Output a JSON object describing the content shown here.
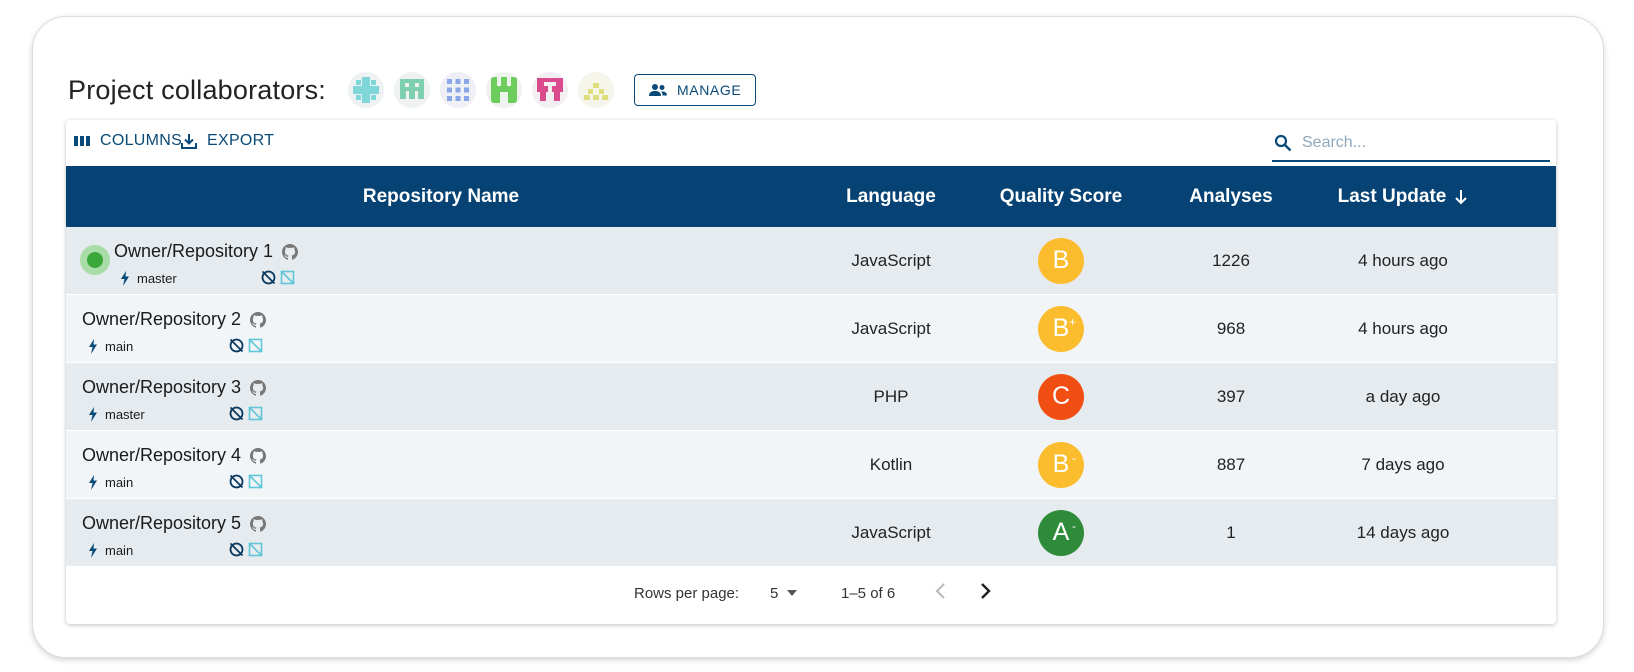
{
  "header": {
    "title": "Project collaborators:",
    "manage_label": "MANAGE",
    "avatars": [
      {
        "icon": "identicon-cyan",
        "color": "#7fd6d9"
      },
      {
        "icon": "identicon-mint",
        "color": "#7fd0b0"
      },
      {
        "icon": "identicon-blue",
        "color": "#8aa8e8"
      },
      {
        "icon": "identicon-green",
        "color": "#6ccc5c"
      },
      {
        "icon": "identicon-pink",
        "color": "#d94b8c"
      },
      {
        "icon": "identicon-yellow",
        "color": "#dede7c"
      }
    ]
  },
  "toolbar": {
    "columns_label": "COLUMNS",
    "export_label": "EXPORT",
    "search_placeholder": "Search..."
  },
  "table": {
    "columns": {
      "repository": "Repository Name",
      "language": "Language",
      "quality": "Quality Score",
      "analyses": "Analyses",
      "last_update": "Last Update"
    },
    "rows": [
      {
        "name": "Owner/Repository 1",
        "branch": "master",
        "language": "JavaScript",
        "grade": "B",
        "grade_mod": "",
        "grade_color": "#fbbc2e",
        "analyses": "1226",
        "last_update": "4 hours ago",
        "active": true
      },
      {
        "name": "Owner/Repository 2",
        "branch": "main",
        "language": "JavaScript",
        "grade": "B",
        "grade_mod": "+",
        "grade_color": "#fbbc2e",
        "analyses": "968",
        "last_update": "4 hours ago",
        "active": false
      },
      {
        "name": "Owner/Repository 3",
        "branch": "master",
        "language": "PHP",
        "grade": "C",
        "grade_mod": "",
        "grade_color": "#f04e12",
        "analyses": "397",
        "last_update": "a day ago",
        "active": false
      },
      {
        "name": "Owner/Repository 4",
        "branch": "main",
        "language": "Kotlin",
        "grade": "B",
        "grade_mod": "-",
        "grade_color": "#fbbc2e",
        "analyses": "887",
        "last_update": "7 days ago",
        "active": false
      },
      {
        "name": "Owner/Repository 5",
        "branch": "main",
        "language": "JavaScript",
        "grade": "A",
        "grade_mod": "-",
        "grade_color": "#2e8b3a",
        "analyses": "1",
        "last_update": "14 days ago",
        "active": false
      }
    ]
  },
  "pagination": {
    "rows_label": "Rows per page:",
    "rows_value": "5",
    "range": "1–5 of 6"
  },
  "colors": {
    "accent": "#0a4a78",
    "header_bg": "#064273"
  }
}
